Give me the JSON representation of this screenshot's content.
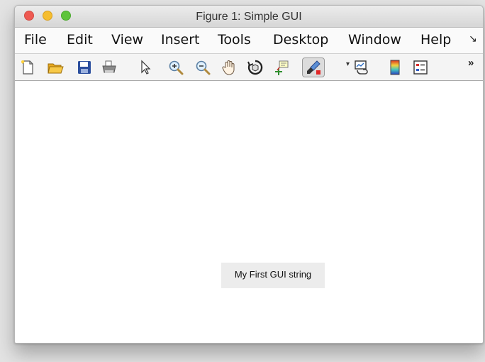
{
  "window": {
    "title": "Figure 1: Simple GUI"
  },
  "menu": {
    "items": [
      "File",
      "Edit",
      "View",
      "Insert",
      "Tools",
      "Desktop",
      "Window",
      "Help"
    ],
    "overflow_icon": "menu-overflow-arrow"
  },
  "toolbar": {
    "icons": [
      "new-figure-icon",
      "open-file-icon",
      "save-icon",
      "print-icon",
      "edit-plot-icon",
      "zoom-in-icon",
      "zoom-out-icon",
      "pan-icon",
      "rotate-3d-icon",
      "data-cursor-icon",
      "brush-icon",
      "brush-dropdown-icon",
      "link-plot-icon",
      "colorbar-icon",
      "legend-icon"
    ],
    "overflow_label": "»"
  },
  "figure": {
    "text": "My First GUI string"
  }
}
